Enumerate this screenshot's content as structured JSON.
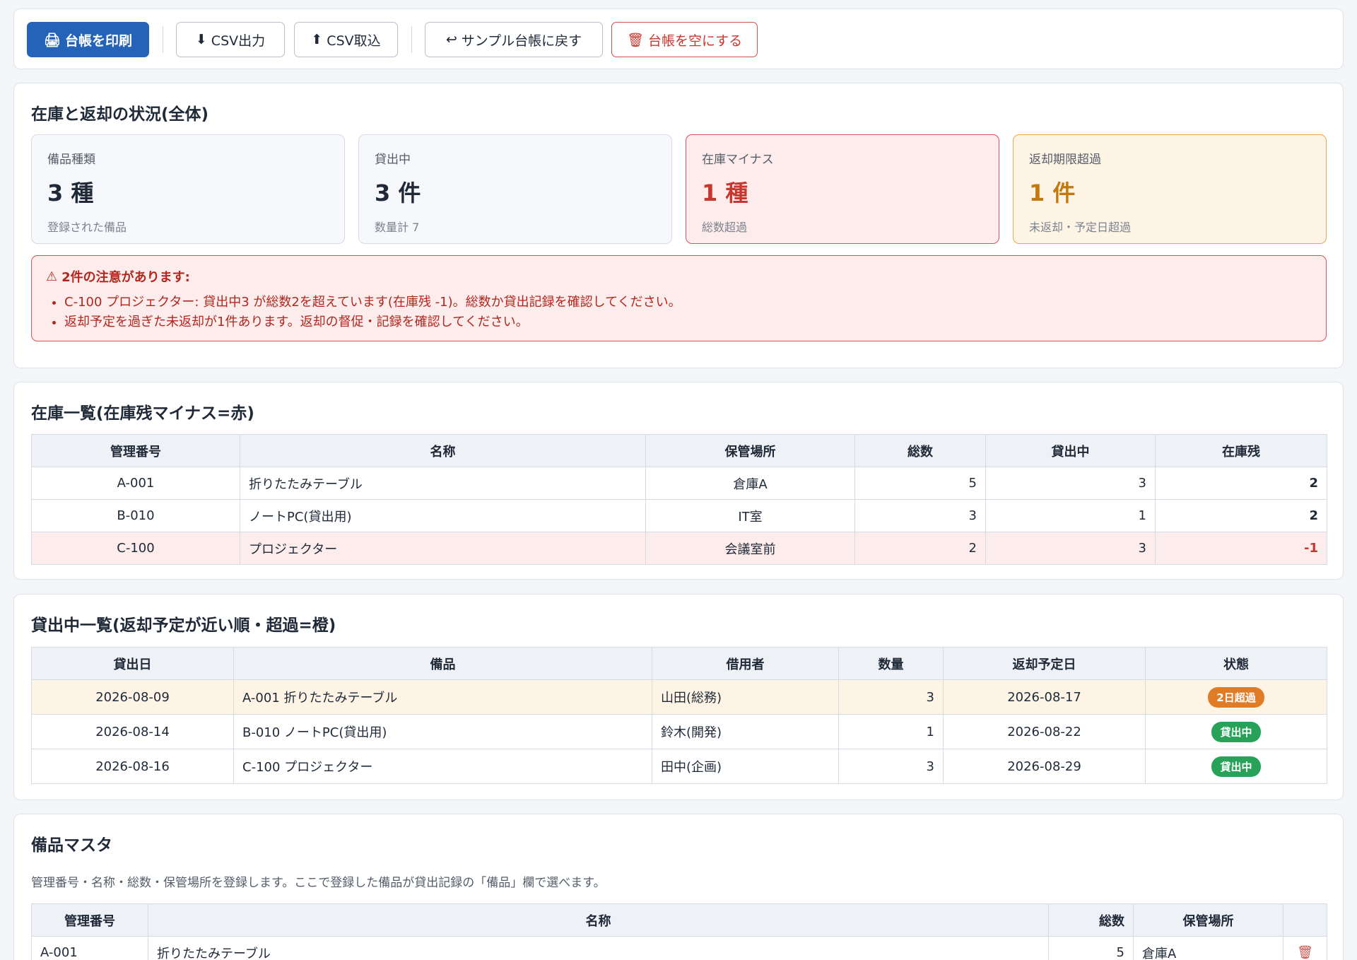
{
  "toolbar": {
    "print_label": "台帳を印刷",
    "csv_export_label": "CSV出力",
    "csv_import_label": "CSV取込",
    "reset_sample_label": "サンプル台帳に戻す",
    "clear_label": "台帳を空にする"
  },
  "summary": {
    "title": "在庫と返却の状況(全体)",
    "cards": [
      {
        "label": "備品種類",
        "value": "3 種",
        "sub": "登録された備品"
      },
      {
        "label": "貸出中",
        "value": "3 件",
        "sub": "数量計 7"
      },
      {
        "label": "在庫マイナス",
        "value": "1 種",
        "sub": "総数超過"
      },
      {
        "label": "返却期限超過",
        "value": "1 件",
        "sub": "未返却・予定日超過"
      }
    ],
    "alert": {
      "heading": "2件の注意があります:",
      "items": [
        "C-100 プロジェクター: 貸出中3 が総数2を超えています(在庫残 -1)。総数か貸出記録を確認してください。",
        "返却予定を過ぎた未返却が1件あります。返却の督促・記録を確認してください。"
      ]
    }
  },
  "inventory": {
    "title": "在庫一覧(在庫残マイナス=赤)",
    "headers": [
      "管理番号",
      "名称",
      "保管場所",
      "総数",
      "貸出中",
      "在庫残"
    ],
    "rows": [
      [
        "A-001",
        "折りたたみテーブル",
        "倉庫A",
        "5",
        "3",
        "2"
      ],
      [
        "B-010",
        "ノートPC(貸出用)",
        "IT室",
        "3",
        "1",
        "2"
      ],
      [
        "C-100",
        "プロジェクター",
        "会議室前",
        "2",
        "3",
        "-1"
      ]
    ]
  },
  "loans": {
    "title": "貸出中一覧(返却予定が近い順・超過=橙)",
    "headers": [
      "貸出日",
      "備品",
      "借用者",
      "数量",
      "返却予定日",
      "状態"
    ],
    "rows": [
      [
        "2026-08-09",
        "A-001 折りたたみテーブル",
        "山田(総務)",
        "3",
        "2026-08-17",
        "2日超過"
      ],
      [
        "2026-08-14",
        "B-010 ノートPC(貸出用)",
        "鈴木(開発)",
        "1",
        "2026-08-22",
        "貸出中"
      ],
      [
        "2026-08-16",
        "C-100 プロジェクター",
        "田中(企画)",
        "3",
        "2026-08-29",
        "貸出中"
      ]
    ]
  },
  "master": {
    "title": "備品マスタ",
    "description": "管理番号・名称・総数・保管場所を登録します。ここで登録した備品が貸出記録の「備品」欄で選べます。",
    "headers": [
      "管理番号",
      "名称",
      "総数",
      "保管場所",
      ""
    ],
    "rows": [
      [
        "A-001",
        "折りたたみテーブル",
        "5",
        "倉庫A"
      ]
    ]
  },
  "colors": {
    "primary": "#2563b8",
    "danger": "#c8372f",
    "warning": "#e07c25",
    "success": "#27a258"
  }
}
